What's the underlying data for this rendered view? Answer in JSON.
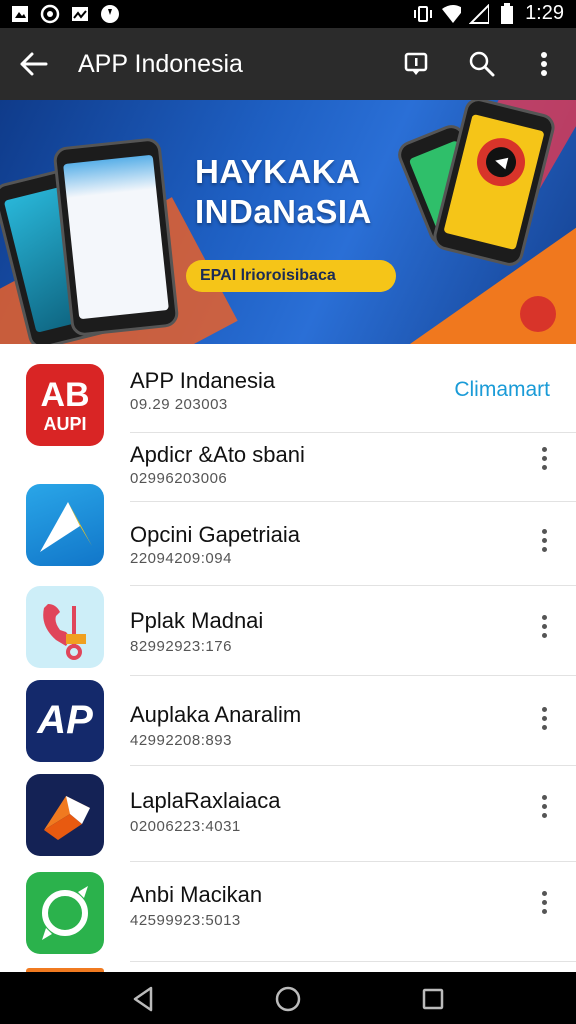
{
  "status_bar": {
    "time": "1:29",
    "icons_left": [
      "photo-icon",
      "sync-icon",
      "image-icon",
      "app-icon"
    ],
    "icons_right": [
      "vibrate-icon",
      "wifi-icon",
      "signal-icon",
      "battery-icon"
    ]
  },
  "app_bar": {
    "title": "APP Indonesia",
    "back_icon": "arrow-left-icon",
    "actions": [
      "feedback-icon",
      "search-icon",
      "more-vert-icon"
    ]
  },
  "banner": {
    "headline_line1": "HAYKAKA",
    "headline_line2": "INDaNaSIA",
    "cta_label": "EPAI lrioroisibaca",
    "colors": {
      "bg": "#1e5fc2",
      "accent": "#f0781e",
      "cta": "#f5c518"
    }
  },
  "apps": [
    {
      "name": "APP Indanesia",
      "sub": "09.29 203003",
      "icon": "ab-aupi-logo",
      "icon_text_1": "AB",
      "icon_text_2": "AUPI",
      "action": "Climamart"
    },
    {
      "name": "Apdicr &Ato sbani",
      "sub": "02996203006",
      "icon": "",
      "action": ""
    },
    {
      "name": "Opcini Gapetriaia",
      "sub": "22094209:094",
      "icon": "navigation-arrow-icon",
      "action": ""
    },
    {
      "name": "Pplak Madnai",
      "sub": "82992923:176",
      "icon": "phone-scooter-icon",
      "action": ""
    },
    {
      "name": "Auplaka Anaralim",
      "sub": "42992208:893",
      "icon": "ap-logo",
      "icon_text_1": "AP",
      "action": ""
    },
    {
      "name": "LaplaRaxlaiaca",
      "sub": "02006223:4031",
      "icon": "play-arrow-logo",
      "action": ""
    },
    {
      "name": "Anbi Macikan",
      "sub": "42599923:5013",
      "icon": "compass-icon",
      "action": ""
    }
  ],
  "nav_bar": {
    "buttons": [
      "back-triangle-icon",
      "home-circle-icon",
      "recents-square-icon"
    ]
  }
}
